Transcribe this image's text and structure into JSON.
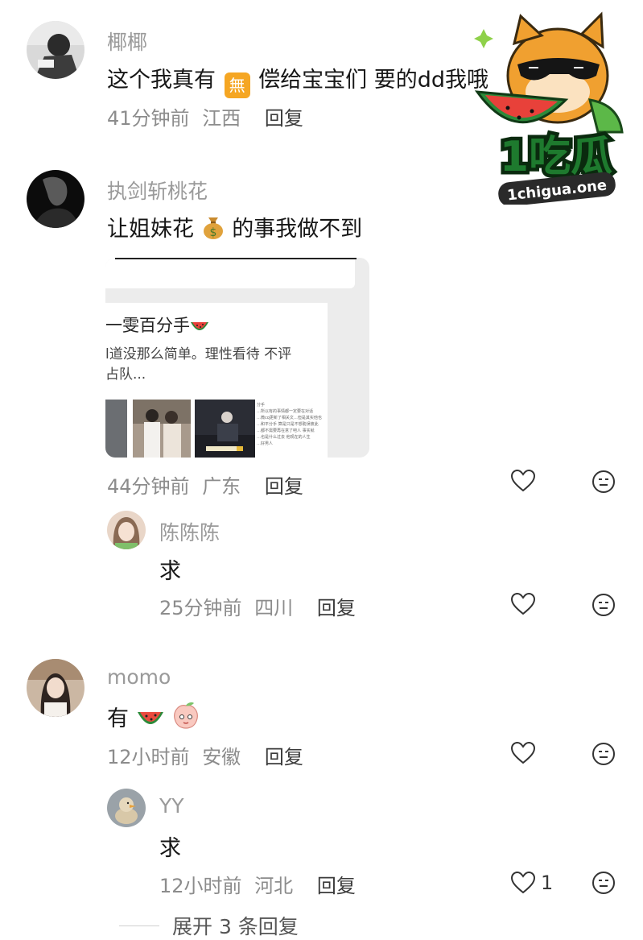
{
  "comments": [
    {
      "username": "椰椰",
      "text_before": "这个我真有",
      "text_after": "偿给宝宝们 要的dd我哦",
      "emoji_badge": "無",
      "time": "41分钟前",
      "location": "江西",
      "reply_label": "回复"
    },
    {
      "username": "执剑斩桃花",
      "text_before": "让姐妹花",
      "text_after": "的事我做不到",
      "emoji_icon": "money-bag-icon",
      "time": "44分钟前",
      "location": "广东",
      "reply_label": "回复",
      "attachment": {
        "title": "一雯百分手",
        "line2": "l道没那么简单。理性看待 不评",
        "line3": "占队...",
        "tiny_text": [
          "分手",
          "…所以有的事情都一定要在对话",
          "…微cq更新了相关文…但是其实他也",
          "…和平分手 算是只是不想耽误彼此",
          "…都不需要再在意了吧人 事实就",
          "…也是什么过去 他现在的人生",
          "…好男人"
        ]
      },
      "replies": [
        {
          "username": "陈陈陈",
          "text": "求",
          "time": "25分钟前",
          "location": "四川",
          "reply_label": "回复"
        }
      ]
    },
    {
      "username": "momo",
      "text_before": "有",
      "emoji_icons": [
        "watermelon-icon",
        "peach-face-icon"
      ],
      "time": "12小时前",
      "location": "安徽",
      "reply_label": "回复",
      "replies": [
        {
          "username": "YY",
          "text": "求",
          "time": "12小时前",
          "location": "河北",
          "reply_label": "回复",
          "like_count": "1"
        }
      ]
    }
  ],
  "expand_label": "展开 3 条回复",
  "watermark": {
    "title": "1吃瓜",
    "url": "1chigua.one"
  },
  "colors": {
    "username": "#9a9a9a",
    "meta": "#8c8c8c",
    "text": "#161616",
    "logo_green": "#1e7a2e",
    "logo_orange": "#f0a030"
  }
}
